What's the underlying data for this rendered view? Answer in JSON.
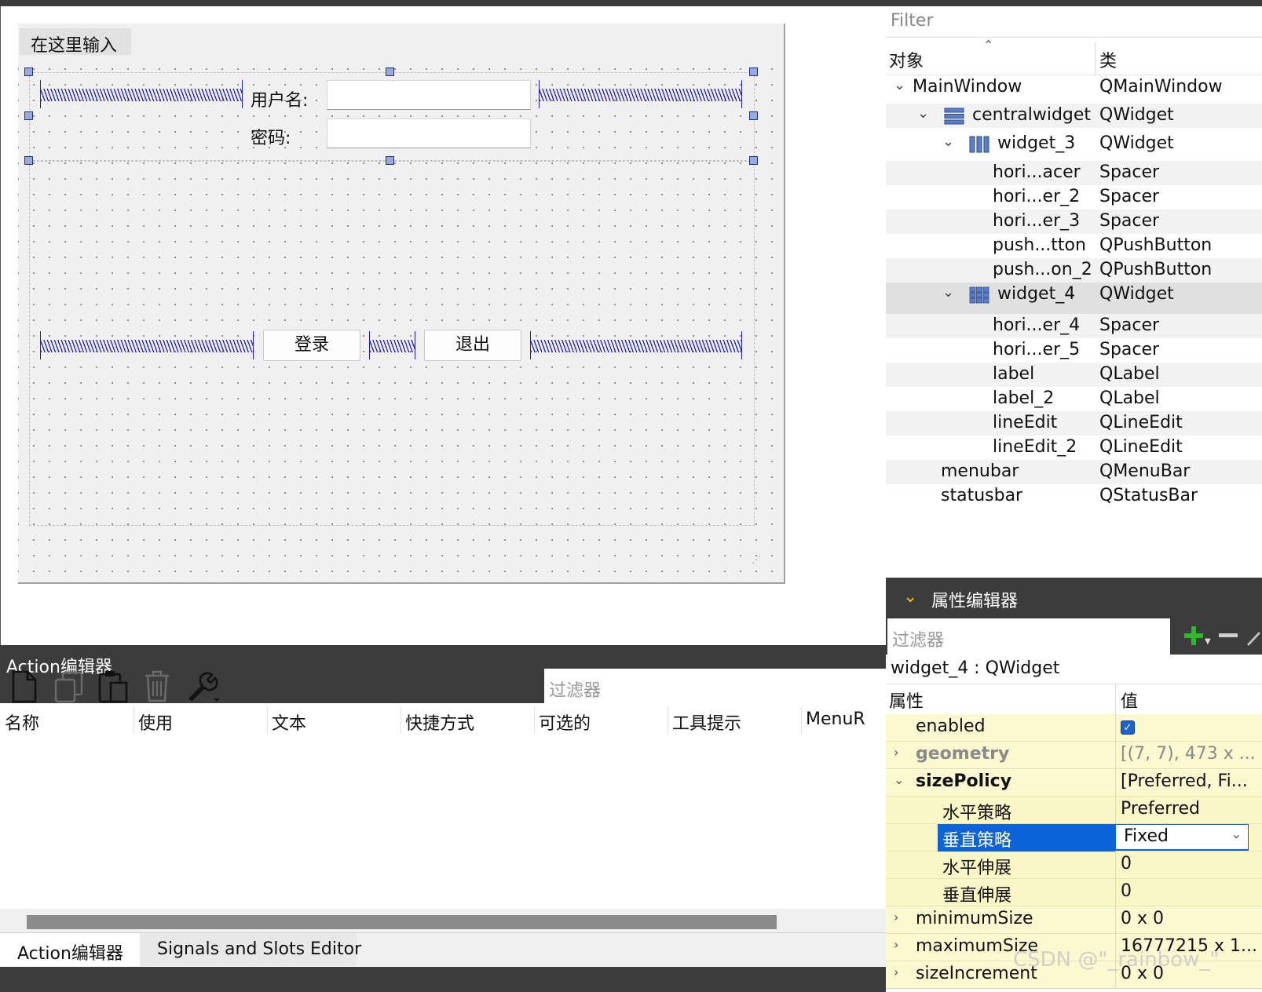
{
  "form": {
    "menu_placeholder": "在这里输入",
    "username_label": "用户名:",
    "password_label": "密码:",
    "login_button": "登录",
    "quit_button": "退出"
  },
  "object_inspector": {
    "filter_placeholder": "Filter",
    "col_object": "对象",
    "col_class": "类",
    "rows": [
      {
        "name": "MainWindow",
        "class": "QMainWindow",
        "level": 0,
        "expanded": true,
        "icon": ""
      },
      {
        "name": "centralwidget",
        "class": "QWidget",
        "level": 1,
        "expanded": true,
        "icon": "vertical-layout-icon"
      },
      {
        "name": "widget_3",
        "class": "QWidget",
        "level": 2,
        "expanded": true,
        "icon": "horizontal-layout-icon"
      },
      {
        "name": "hori...acer",
        "class": "Spacer",
        "level": 3
      },
      {
        "name": "hori...er_2",
        "class": "Spacer",
        "level": 3
      },
      {
        "name": "hori...er_3",
        "class": "Spacer",
        "level": 3
      },
      {
        "name": "push...tton",
        "class": "QPushButton",
        "level": 3
      },
      {
        "name": "push...on_2",
        "class": "QPushButton",
        "level": 3
      },
      {
        "name": "widget_4",
        "class": "QWidget",
        "level": 2,
        "expanded": true,
        "icon": "grid-layout-icon",
        "selected": true
      },
      {
        "name": "hori...er_4",
        "class": "Spacer",
        "level": 3
      },
      {
        "name": "hori...er_5",
        "class": "Spacer",
        "level": 3
      },
      {
        "name": "label",
        "class": "QLabel",
        "level": 3
      },
      {
        "name": "label_2",
        "class": "QLabel",
        "level": 3
      },
      {
        "name": "lineEdit",
        "class": "QLineEdit",
        "level": 3
      },
      {
        "name": "lineEdit_2",
        "class": "QLineEdit",
        "level": 3
      },
      {
        "name": "menubar",
        "class": "QMenuBar",
        "level": 1
      },
      {
        "name": "statusbar",
        "class": "QStatusBar",
        "level": 1
      }
    ]
  },
  "property_editor": {
    "title": "属性编辑器",
    "filter_placeholder": "过滤器",
    "object_label": "widget_4 : QWidget",
    "col_property": "属性",
    "col_value": "值",
    "rows": [
      {
        "key": "enabled",
        "value": "",
        "checkbox": true
      },
      {
        "key": "geometry",
        "value": "[(7, 7), 473 x ...",
        "expandable": true,
        "bold": true,
        "gray": true
      },
      {
        "key": "sizePolicy",
        "value": "[Preferred, Fi...",
        "expandable": true,
        "expanded": true,
        "bold": true
      },
      {
        "key": "水平策略",
        "value": "Preferred",
        "child": true
      },
      {
        "key": "垂直策略",
        "value": "Fixed",
        "child": true,
        "selected": true,
        "dropdown": true
      },
      {
        "key": "水平伸展",
        "value": "0",
        "child": true
      },
      {
        "key": "垂直伸展",
        "value": "0",
        "child": true
      },
      {
        "key": "minimumSize",
        "value": "0 x 0",
        "expandable": true
      },
      {
        "key": "maximumSize",
        "value": "16777215 x 1...",
        "expandable": true
      },
      {
        "key": "sizeIncrement",
        "value": "0 x 0",
        "expandable": true
      }
    ]
  },
  "action_editor": {
    "title": "Action编辑器",
    "filter_placeholder": "过滤器",
    "columns": [
      "名称",
      "使用",
      "文本",
      "快捷方式",
      "可选的",
      "工具提示",
      "MenuR"
    ],
    "tabs": [
      "Action编辑器",
      "Signals and Slots Editor"
    ]
  },
  "watermark": "CSDN @\"_rainbow_\"",
  "colors": {
    "dark_bg": "#3c3c3c",
    "spacer_blue": "#1c1ccc",
    "selection_blue": "#0a64d8",
    "property_yellow": "#fcf8d0",
    "add_green": "#2db82d"
  }
}
